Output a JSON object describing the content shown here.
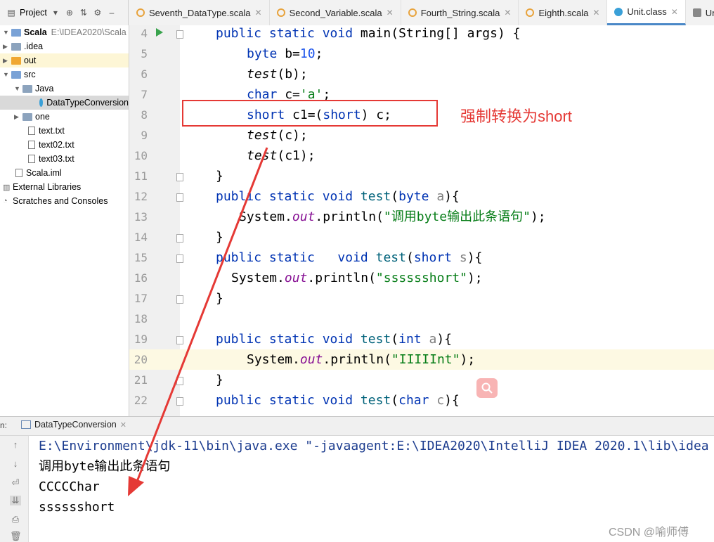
{
  "project_bar": {
    "label": "Project"
  },
  "tabs": [
    {
      "label": "Seventh_DataType.scala",
      "color": "#e8a33d"
    },
    {
      "label": "Second_Variable.scala",
      "color": "#e8a33d"
    },
    {
      "label": "Fourth_String.scala",
      "color": "#e8a33d"
    },
    {
      "label": "Eighth.scala",
      "color": "#e8a33d"
    },
    {
      "label": "Unit.class",
      "color": "#3aa0d8"
    },
    {
      "label": "Unit.de",
      "color": "#888888"
    }
  ],
  "tree": {
    "root_name": "Scala",
    "root_path": "E:\\IDEA2020\\Scala",
    "items": [
      {
        "label": ".idea"
      },
      {
        "label": "out"
      },
      {
        "label": "src"
      },
      {
        "label": "Java"
      },
      {
        "label": "DataTypeConversion"
      },
      {
        "label": "one"
      },
      {
        "label": "text.txt"
      },
      {
        "label": "text02.txt"
      },
      {
        "label": "text03.txt"
      },
      {
        "label": "Scala.iml"
      },
      {
        "label": "External Libraries"
      },
      {
        "label": "Scratches and Consoles"
      }
    ]
  },
  "line_numbers": [
    "4",
    "5",
    "6",
    "7",
    "8",
    "9",
    "10",
    "11",
    "12",
    "13",
    "14",
    "15",
    "16",
    "17",
    "18",
    "19",
    "20",
    "21",
    "22"
  ],
  "code": {
    "l4": {
      "kw": "public static void",
      "rest": " main(String[] args) {"
    },
    "l5": {
      "kw": "byte",
      "rest1": " b=",
      "num": "10",
      "rest2": ";"
    },
    "l6": {
      "fn": "test",
      "rest": "(b);"
    },
    "l7": {
      "kw": "char",
      "rest1": " c=",
      "str": "'a'",
      "rest2": ";"
    },
    "l8": {
      "kw": "short",
      "rest1": " c1=(",
      "kw2": "short",
      "rest2": ") c;"
    },
    "l9": {
      "fn": "test",
      "rest": "(c);"
    },
    "l10": {
      "fn": "test",
      "rest": "(c1);"
    },
    "l11": "}",
    "l12": {
      "kw": "public static void",
      "fn": "test",
      "p1": "(",
      "kw2": "byte",
      "param": " a",
      "p2": "){"
    },
    "l13": {
      "cls": "System.",
      "fld": "out",
      "rest1": ".println(",
      "str": "\"调用byte输出此条语句\"",
      "rest2": ");"
    },
    "l14": "}",
    "l15": {
      "kw": "public static",
      "sp": "  ",
      "kw3": "void",
      "fn": "test",
      "p1": "(",
      "kw2": "short",
      "param": " s",
      "p2": "){"
    },
    "l16": {
      "cls": "System.",
      "fld": "out",
      "rest1": ".println(",
      "str": "\"sssssshort\"",
      "rest2": ");"
    },
    "l17": "}",
    "l19": {
      "kw": "public static void",
      "fn": "test",
      "p1": "(",
      "kw2": "int",
      "param": " a",
      "p2": "){"
    },
    "l20": {
      "cls": "System.",
      "fld": "out",
      "rest1": ".println(",
      "str": "\"IIIIInt\"",
      "rest2": ");"
    },
    "l21": "}",
    "l22": {
      "kw": "public static void",
      "fn": "test",
      "p1": "(",
      "kw2": "char",
      "param": " c",
      "p2": "){"
    }
  },
  "annotation": {
    "text": "强制转换为short",
    "color": "#e53935"
  },
  "run_panel": {
    "label": "n:",
    "tab": "DataTypeConversion",
    "output": [
      "E:\\Environment\\jdk-11\\bin\\java.exe \"-javaagent:E:\\IDEA2020\\IntelliJ IDEA 2020.1\\lib\\idea",
      "调用byte输出此条语句",
      "CCCCChar",
      "sssssshort"
    ]
  },
  "watermark": "CSDN @喻师傅"
}
